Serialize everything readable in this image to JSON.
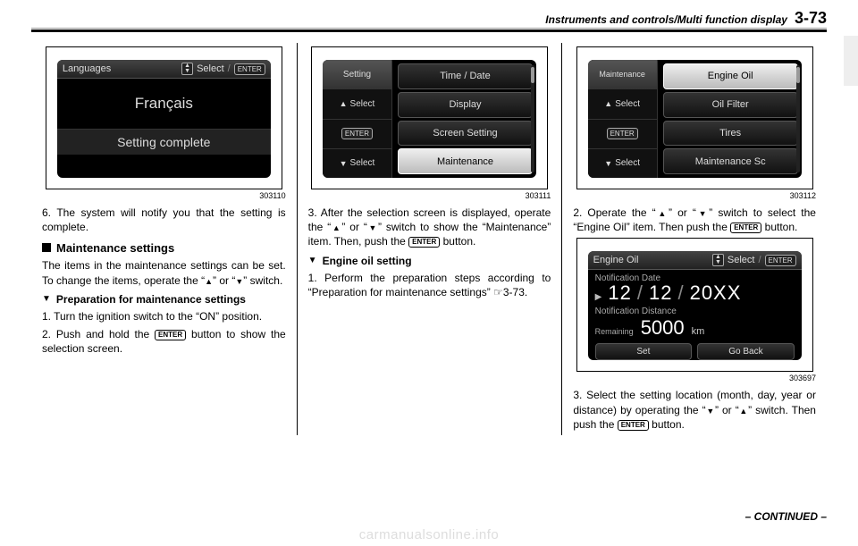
{
  "header": {
    "path": "Instruments and controls/Multi function display",
    "page": "3-73"
  },
  "footer": "– CONTINUED –",
  "watermark": "carmanualsonline.info",
  "col1": {
    "fig": {
      "id": "303110",
      "title": "Languages",
      "select_label": "Select",
      "enter_label": "ENTER",
      "language": "Français",
      "status": "Setting complete"
    },
    "p1": "6. The system will notify you that the setting is complete.",
    "h1": "Maintenance settings",
    "p2_a": "The items in the maintenance settings can be set. To change the items, operate the “",
    "p2_b": "” or “",
    "p2_c": "” switch.",
    "h2": "Preparation for maintenance settings",
    "p3": "1. Turn the ignition switch to the “ON” position.",
    "p4_a": "2. Push and hold the ",
    "p4_b": " button to show the selection screen.",
    "enter_inline": "ENTER"
  },
  "col2": {
    "fig": {
      "id": "303111",
      "left": {
        "head": "Setting",
        "up": "Select",
        "enter": "ENTER",
        "down": "Select"
      },
      "items": [
        "Time / Date",
        "Display",
        "Screen Setting",
        "Maintenance"
      ],
      "selected_index": 3
    },
    "p1_a": "3. After the selection screen is displayed, operate the “",
    "p1_b": "” or “",
    "p1_c": "” switch to show the “Maintenance” item. Then, push the ",
    "p1_d": " button.",
    "enter_inline": "ENTER",
    "h1": "Engine oil setting",
    "p2": "1. Perform the preparation steps according to “Preparation for maintenance settings” ☞3-73."
  },
  "col3": {
    "fig1": {
      "id": "303112",
      "left": {
        "head": "Maintenance",
        "up": "Select",
        "enter": "ENTER",
        "down": "Select"
      },
      "items": [
        "Engine Oil",
        "Oil Filter",
        "Tires",
        "Maintenance Sc"
      ],
      "selected_index": 0
    },
    "p1_a": "2. Operate the “",
    "p1_b": "” or “",
    "p1_c": "” switch to select the “Engine Oil” item. Then push the ",
    "p1_d": " button.",
    "enter_inline": "ENTER",
    "fig2": {
      "id": "303697",
      "title": "Engine Oil",
      "select_label": "Select",
      "enter_label": "ENTER",
      "notif_date_label": "Notification Date",
      "date_m": "12",
      "date_d": "12",
      "date_y": "20XX",
      "notif_dist_label": "Notification Distance",
      "remaining_label": "Remaining",
      "dist_value": "5000",
      "dist_unit": "km",
      "btn_set": "Set",
      "btn_back": "Go Back"
    },
    "p2_a": "3. Select the setting location (month, day, year or distance) by operating the “",
    "p2_b": "” or “",
    "p2_c": "” switch. Then push the ",
    "p2_d": " button."
  }
}
